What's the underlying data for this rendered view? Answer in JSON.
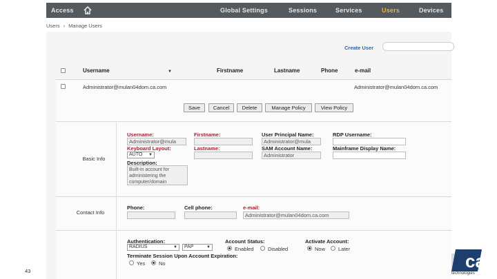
{
  "nav": {
    "access": "Access",
    "home_icon": "home-icon",
    "items": [
      "Global Settings",
      "Sessions",
      "Services",
      "Users",
      "Devices"
    ],
    "active": "Users",
    "active_color": "#f2b233",
    "bar_color": "#555a5e"
  },
  "breadcrumb": {
    "root": "Users",
    "separator": "›",
    "current": "Manage Users"
  },
  "toolbar": {
    "create_user": "Create User",
    "search_value": ""
  },
  "table": {
    "headers": {
      "username": "Username",
      "firstname": "Firstname",
      "lastname": "Lastname",
      "phone": "Phone",
      "email": "e-mail"
    },
    "row": {
      "username": "Administrator@mulan04dom.ca.com",
      "email": "Administrator@mulan04dom.ca.com"
    }
  },
  "actions": [
    "Save",
    "Cancel",
    "Delete",
    "Manage Policy",
    "View Policy"
  ],
  "basic_info": {
    "section_label": "Basic Info",
    "username_label": "Username:",
    "username_value": "Administrator@mula",
    "firstname_label": "Firstname:",
    "firstname_value": "",
    "upn_label": "User Principal Name:",
    "upn_value": "Administrator@mula",
    "rdp_label": "RDP Username:",
    "rdp_value": "",
    "keyboard_label": "Keyboard Layout:",
    "keyboard_value": "AUTO",
    "lastname_label": "Lastname:",
    "lastname_value": "",
    "sam_label": "SAM Account Name:",
    "sam_value": "Administrator",
    "mainframe_label": "Mainframe Display Name:",
    "mainframe_value": "",
    "description_label": "Description:",
    "description_lines": [
      "Built-in account for",
      "administering the",
      "computer/domain"
    ]
  },
  "contact_info": {
    "section_label": "Contact Info",
    "phone_label": "Phone:",
    "phone_value": "",
    "cell_label": "Cell phone:",
    "cell_value": "",
    "email_label": "e-mail:",
    "email_value": "Administrator@mulan04dom.ca.com"
  },
  "auth": {
    "auth_label": "Authentication:",
    "auth_value": "RADIUS",
    "auth_sub_value": "PAP",
    "status_label": "Account Status:",
    "status_enabled": "Enabled",
    "status_disabled": "Disabled",
    "status_selected": "Enabled",
    "activate_label": "Activate Account:",
    "activate_now": "Now",
    "activate_later": "Later",
    "activate_selected": "Now",
    "terminate_label": "Terminate Session Upon Account Expiration:",
    "terminate_yes": "Yes",
    "terminate_no": "No",
    "terminate_selected": "No"
  },
  "footer": {
    "page_number": "43",
    "logo_text": "ca",
    "logo_tagline": "technologies",
    "logo_color": "#1d3f6e"
  }
}
